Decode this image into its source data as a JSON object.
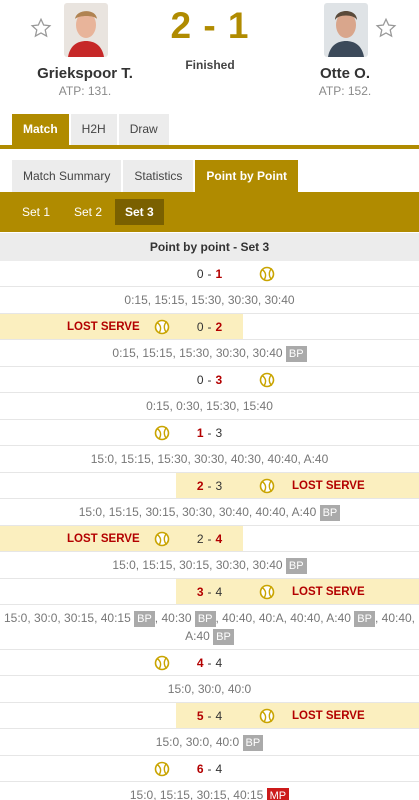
{
  "match": {
    "home": {
      "name": "Griekspoor T.",
      "rank": "ATP: 131."
    },
    "away": {
      "name": "Otte O.",
      "rank": "ATP: 152."
    },
    "score": "2 - 1",
    "status": "Finished"
  },
  "tabs": [
    "Match",
    "H2H",
    "Draw"
  ],
  "subtabs": [
    "Match Summary",
    "Statistics",
    "Point by Point"
  ],
  "sets": [
    "Set 1",
    "Set 2",
    "Set 3"
  ],
  "section_title": "Point by point - Set 3",
  "lost_serve_label": "LOST SERVE",
  "colors": {
    "accent": "#b08b00",
    "highlight": "#fbefbf",
    "loss": "#b30000",
    "badge": "#aaaaaa",
    "match_point": "#cc1a1a"
  },
  "games": [
    {
      "home": "0",
      "away": "1",
      "server": "away",
      "lost_serve": null,
      "points": [
        {
          "text": "0:15, 15:15, 15:30, 30:30, 30:40"
        }
      ]
    },
    {
      "home": "0",
      "away": "2",
      "server": "home",
      "lost_serve": "home",
      "points": [
        {
          "text": "0:15, 15:15, 15:30, 30:30, 30:40",
          "badge": "BP"
        }
      ]
    },
    {
      "home": "0",
      "away": "3",
      "server": "away",
      "lost_serve": null,
      "points": [
        {
          "text": "0:15, 0:30, 15:30, 15:40"
        }
      ]
    },
    {
      "home": "1",
      "away": "3",
      "server": "home",
      "lost_serve": null,
      "points": [
        {
          "text": "15:0, 15:15, 15:30, 30:30, 40:30, 40:40, A:40"
        }
      ]
    },
    {
      "home": "2",
      "away": "3",
      "server": "away",
      "lost_serve": "away",
      "points": [
        {
          "text": "15:0, 15:15, 30:15, 30:30, 30:40, 40:40, A:40",
          "badge": "BP"
        }
      ]
    },
    {
      "home": "2",
      "away": "4",
      "server": "home",
      "lost_serve": "home",
      "points": [
        {
          "text": "15:0, 15:15, 30:15, 30:30, 30:40",
          "badge": "BP"
        }
      ]
    },
    {
      "home": "3",
      "away": "4",
      "server": "away",
      "lost_serve": "away",
      "points": [
        {
          "text": "15:0, 30:0, 30:15, 40:15",
          "badge": "BP"
        },
        {
          "text": ", 40:30",
          "badge": "BP"
        },
        {
          "text": ", 40:40, 40:A, 40:40, A:40",
          "badge": "BP"
        },
        {
          "text": ", 40:40, A:40",
          "badge": "BP"
        }
      ]
    },
    {
      "home": "4",
      "away": "4",
      "server": "home",
      "lost_serve": null,
      "points": [
        {
          "text": "15:0, 30:0, 40:0"
        }
      ]
    },
    {
      "home": "5",
      "away": "4",
      "server": "away",
      "lost_serve": "away",
      "points": [
        {
          "text": "15:0, 30:0, 40:0",
          "badge": "BP"
        }
      ]
    },
    {
      "home": "6",
      "away": "4",
      "server": "home",
      "lost_serve": null,
      "points": [
        {
          "text": "15:0, 15:15, 30:15, 40:15",
          "badge": "MP"
        }
      ]
    }
  ]
}
